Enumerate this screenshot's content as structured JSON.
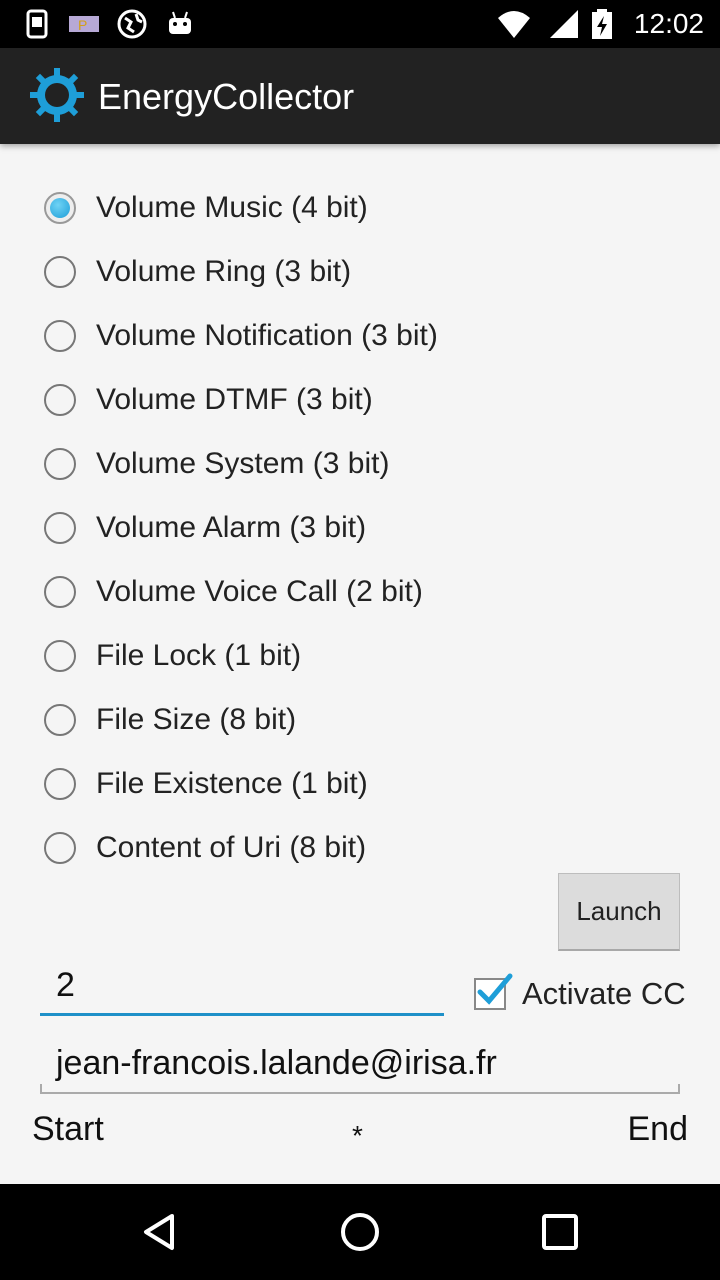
{
  "status_bar": {
    "time": "12:02",
    "icons": [
      "screenshot-icon",
      "parking-app-icon",
      "globe-icon",
      "android-icon",
      "wifi-icon",
      "signal-icon",
      "battery-charging-icon"
    ]
  },
  "action_bar": {
    "title": "EnergyCollector",
    "logo_icon": "sun-gear-icon"
  },
  "radio_options": [
    {
      "label": "Volume Music (4 bit)",
      "checked": true
    },
    {
      "label": "Volume Ring (3 bit)",
      "checked": false
    },
    {
      "label": "Volume Notification (3 bit)",
      "checked": false
    },
    {
      "label": "Volume DTMF (3 bit)",
      "checked": false
    },
    {
      "label": "Volume System (3 bit)",
      "checked": false
    },
    {
      "label": "Volume Alarm (3 bit)",
      "checked": false
    },
    {
      "label": "Volume Voice Call (2 bit)",
      "checked": false
    },
    {
      "label": "File Lock (1 bit)",
      "checked": false
    },
    {
      "label": "File Size (8 bit)",
      "checked": false
    },
    {
      "label": "File Existence (1 bit)",
      "checked": false
    },
    {
      "label": "Content of Uri (8 bit)",
      "checked": false
    }
  ],
  "launch_button": "Launch",
  "number_input": "2",
  "activate_cc": {
    "label": "Activate CC",
    "checked": true
  },
  "email_input": "jean-francois.lalande@irisa.fr",
  "footer": {
    "start": "Start",
    "middle": "*",
    "end": "End"
  },
  "colors": {
    "accent": "#1e9ed8",
    "action_bar": "#222222",
    "background": "#f5f5f5"
  },
  "nav_bar": [
    "back-icon",
    "home-icon",
    "recents-icon"
  ]
}
